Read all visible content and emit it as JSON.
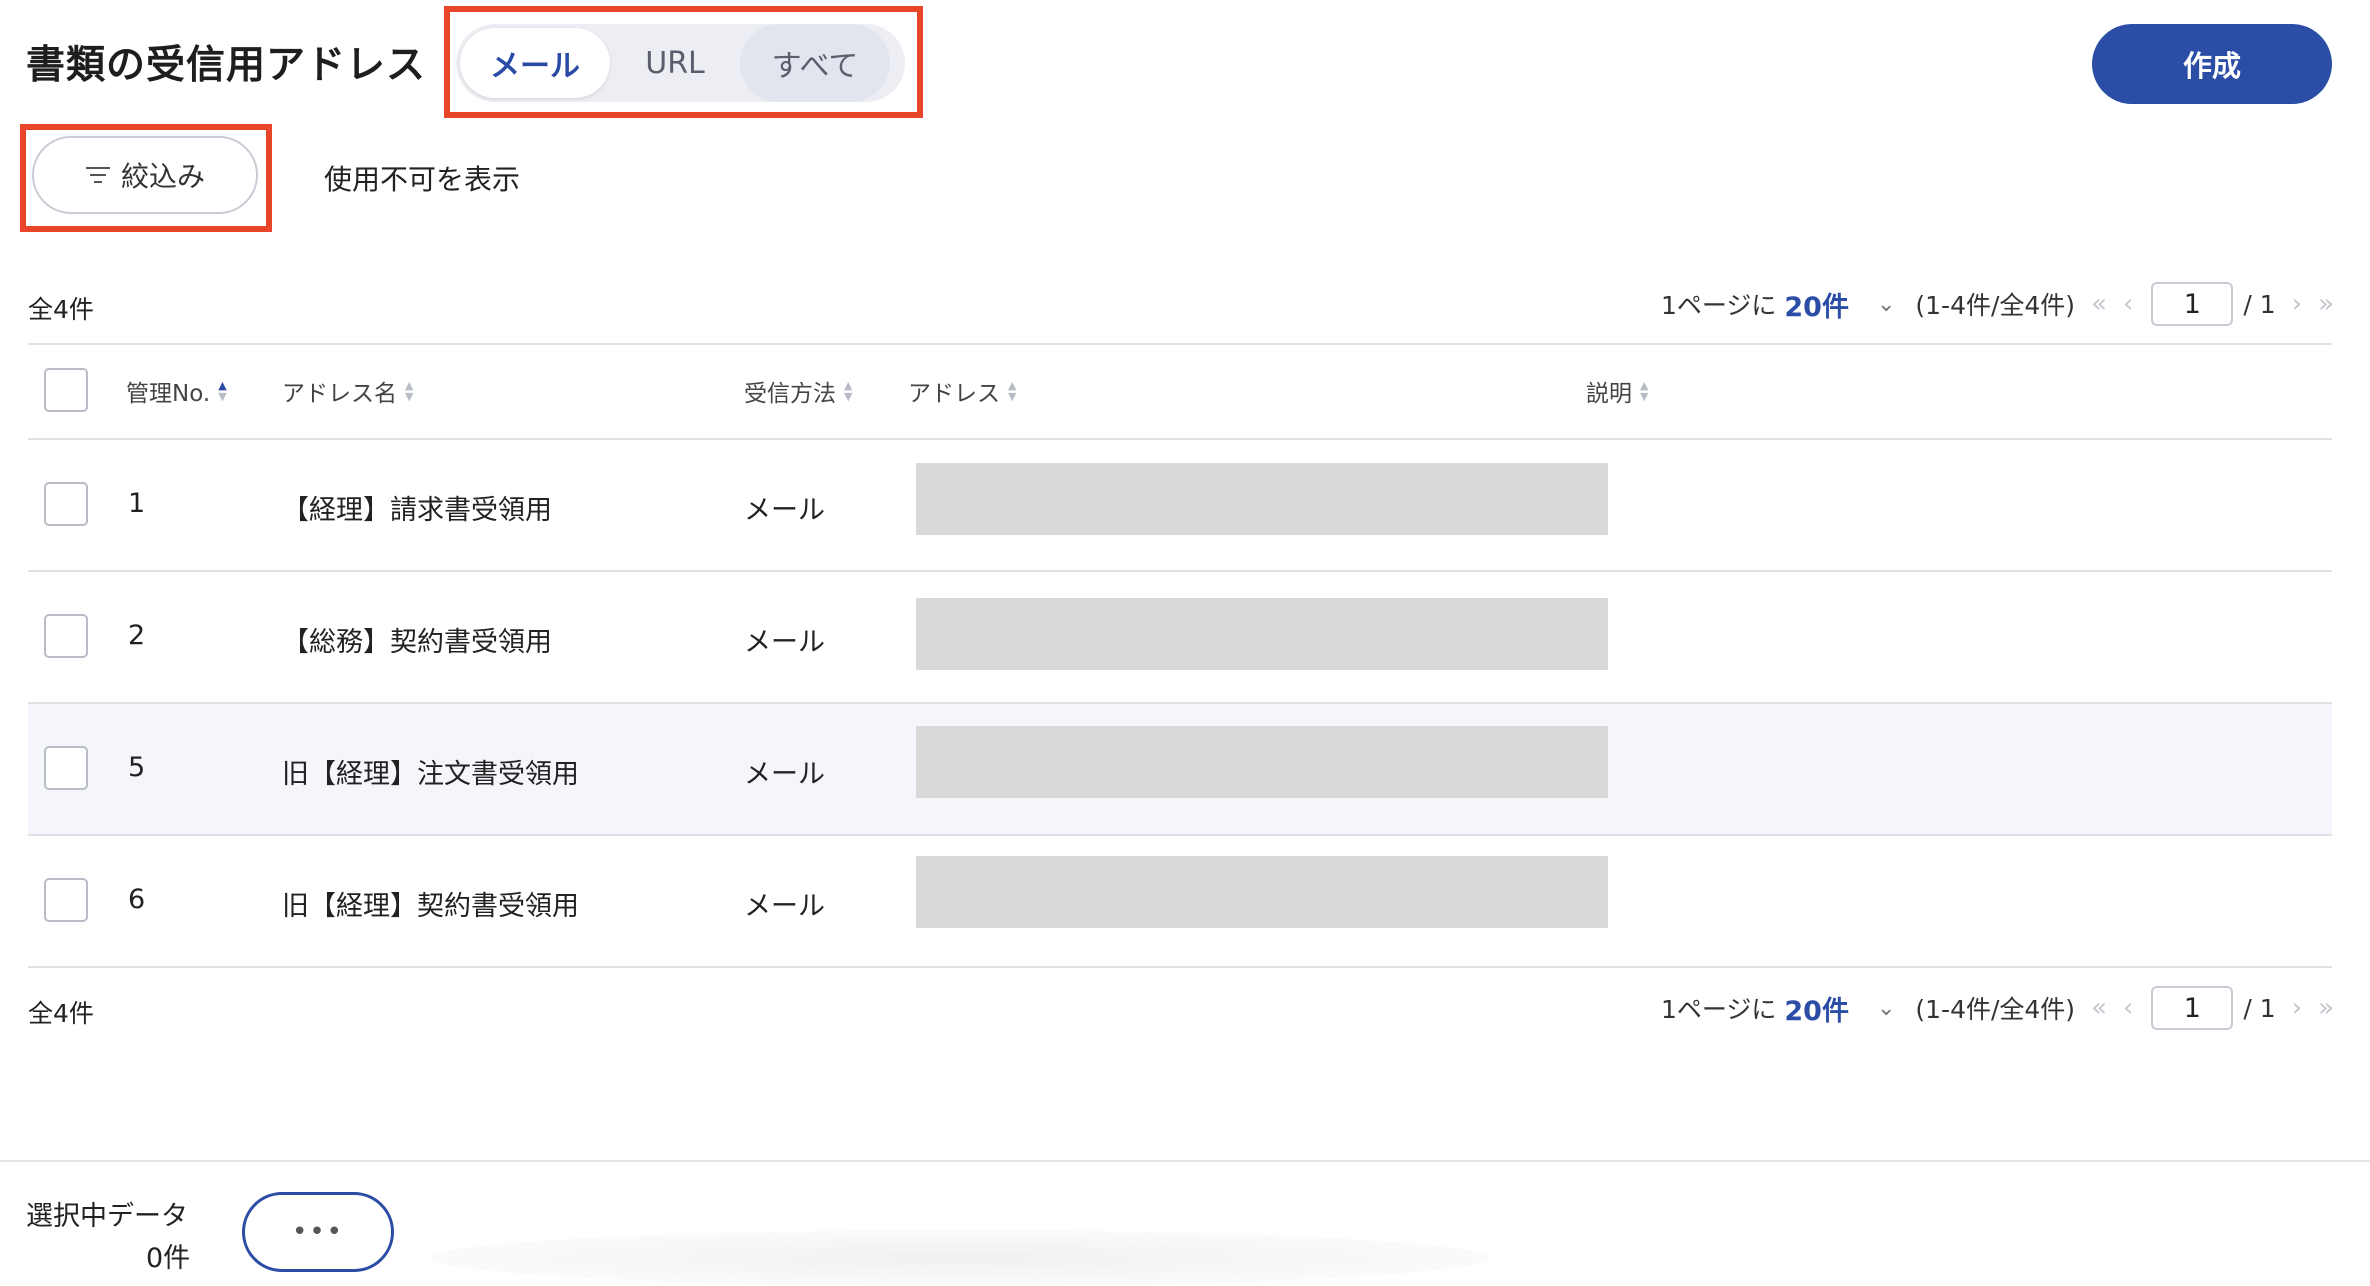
{
  "header": {
    "title": "書類の受信用アドレス",
    "tabs": [
      {
        "label": "メール",
        "active": true
      },
      {
        "label": "URL",
        "active": false
      },
      {
        "label": "すべて",
        "active": false
      }
    ],
    "create_label": "作成"
  },
  "filters": {
    "filter_label": "絞込み",
    "show_disabled_label": "使用不可を表示"
  },
  "summary": {
    "total_label": "全4件",
    "per_page_prefix": "1ページに",
    "per_page_value": "20件",
    "range_label": "(1-4件/全4件)",
    "current_page": "1",
    "of_pages": "/ 1"
  },
  "table": {
    "columns": [
      "管理No.",
      "アドレス名",
      "受信方法",
      "アドレス",
      "説明"
    ],
    "rows": [
      {
        "no": "1",
        "name": "【経理】請求書受領用",
        "method": "メール"
      },
      {
        "no": "2",
        "name": "【総務】契約書受領用",
        "method": "メール"
      },
      {
        "no": "5",
        "name": "旧【経理】注文書受領用",
        "method": "メール"
      },
      {
        "no": "6",
        "name": "旧【経理】契約書受領用",
        "method": "メール"
      }
    ]
  },
  "footer": {
    "selected_label": "選択中データ",
    "selected_count": "0件",
    "more_label": "•••"
  },
  "colors": {
    "accent": "#2c4da5",
    "highlight_box": "#e8452a",
    "redaction": "#d9d9d9"
  }
}
